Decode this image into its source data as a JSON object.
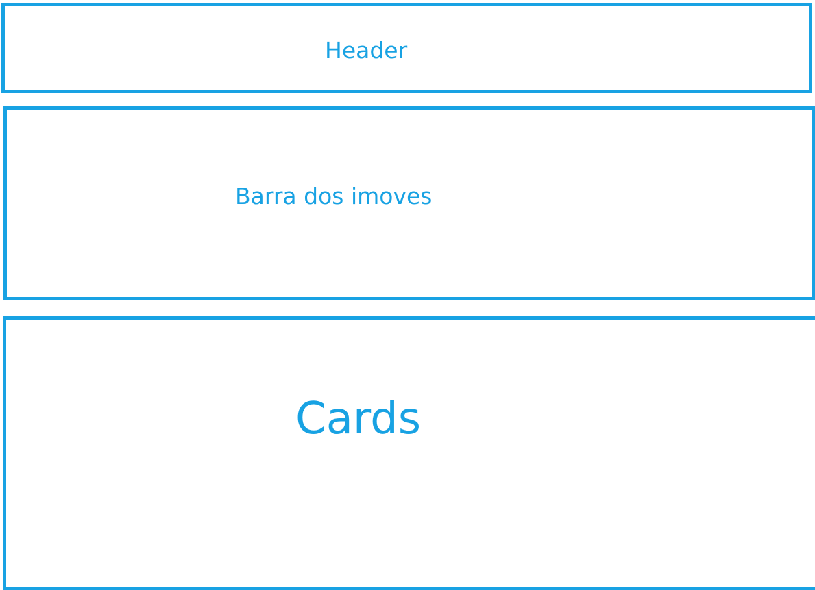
{
  "diagram": {
    "sections": [
      {
        "id": "header",
        "label": "Header"
      },
      {
        "id": "bar",
        "label": "Barra dos imoves"
      },
      {
        "id": "cards",
        "label": "Cards"
      }
    ],
    "colors": {
      "accent": "#18a2e3",
      "background": "#ffffff"
    }
  }
}
